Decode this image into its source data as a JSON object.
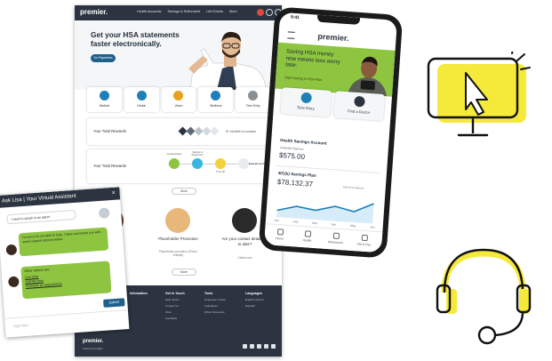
{
  "colors": {
    "accent_green": "#8dc540",
    "navy": "#2b3440",
    "yellow": "#f5e93a",
    "blue": "#1f7fb8"
  },
  "desktop": {
    "logo": "premier.",
    "nav_links": [
      "Health Accounts",
      "Savings & Retirement",
      "Life Events",
      "More"
    ],
    "hero_title": "Get your HSA statements faster electronically.",
    "hero_cta": "Go Paperless",
    "quick_links": [
      {
        "label": "Medical",
        "color": "#1f7fb8",
        "icon": "medical-bag-icon"
      },
      {
        "label": "Dental",
        "color": "#1f7fb8",
        "icon": "tooth-icon"
      },
      {
        "label": "Vision",
        "color": "#e8a21c",
        "icon": "glasses-icon"
      },
      {
        "label": "Wellness",
        "color": "#1f7fb8",
        "icon": "wellness-icon"
      },
      {
        "label": "Time Entry",
        "color": "#8a8f94",
        "icon": "arrow-icon"
      }
    ],
    "rewards_title": "Your Total Rewards",
    "rewards_note": "5+ benefits to consider",
    "rewards2_title": "Your Total Rewards",
    "rewards2_steps": [
      "Compensation",
      "Savings & Retirement",
      "Time Off",
      "Extra Rewards"
    ],
    "more_1": "More",
    "promos": [
      {
        "title": "Start Health?",
        "sub": ""
      },
      {
        "title": "Placeholder Promotion",
        "sub": "Placeholder promotion (Promo Subtitle)"
      },
      {
        "title": "Are your contact details up to date?",
        "sub": "Check now"
      }
    ],
    "more_2": "More",
    "footer_cols": [
      {
        "head": "Information",
        "items": [
          "",
          "",
          ""
        ]
      },
      {
        "head": "Get in Touch",
        "items": [
          "Help Topics",
          "Contact Us",
          "Chat",
          "Feedback"
        ]
      },
      {
        "head": "Tools",
        "items": [
          "Employee Locator",
          "Calculators",
          "Other Resources"
        ]
      },
      {
        "head": "Languages",
        "items": [
          "English Version",
          "Español"
        ]
      }
    ],
    "footer_logo": "premier.",
    "footer_copy": "Powered by Alight"
  },
  "chat": {
    "title": "Ask Lisa | Your Virtual Assistant",
    "close": "×",
    "user_msg": "I need to speak to an agent",
    "bot_msg_1": "I'm sorry I'm not able to help. I have connected you with some support options below:",
    "bot_msg_2": "Other options are:",
    "links": [
      "Live Chat",
      "Call Me Now",
      "Schedule an Appointment"
    ],
    "submit": "Submit",
    "placeholder": "Type here"
  },
  "phone": {
    "time": "9:41",
    "logo": "premier.",
    "hero_text": "Saving HSA money now means less worry later.",
    "hero_sub": "Start Saving in HSA Plan",
    "tile_1": "Time Entry",
    "tile_2": "Find a Doctor",
    "hsa_title": "Health Savings Account",
    "hsa_sub": "Available Balance",
    "hsa_amount": "$575.00",
    "k_title": "401(k) Savings Plan",
    "k_amount": "$78,132.37",
    "k_note": "valued at balance",
    "chart_months": [
      "Jan",
      "Feb",
      "Mar",
      "Apr",
      "May",
      "Jun"
    ],
    "tabs": [
      "Home",
      "Health",
      "Retirement",
      "Life & Pay"
    ]
  },
  "chart_data": {
    "type": "area",
    "x": [
      "Jan",
      "Feb",
      "Mar",
      "Apr",
      "May",
      "Jun"
    ],
    "series": [
      {
        "values": [
          60,
          68,
          64,
          72,
          66,
          80
        ]
      }
    ],
    "title": "401(k) Savings Plan"
  }
}
